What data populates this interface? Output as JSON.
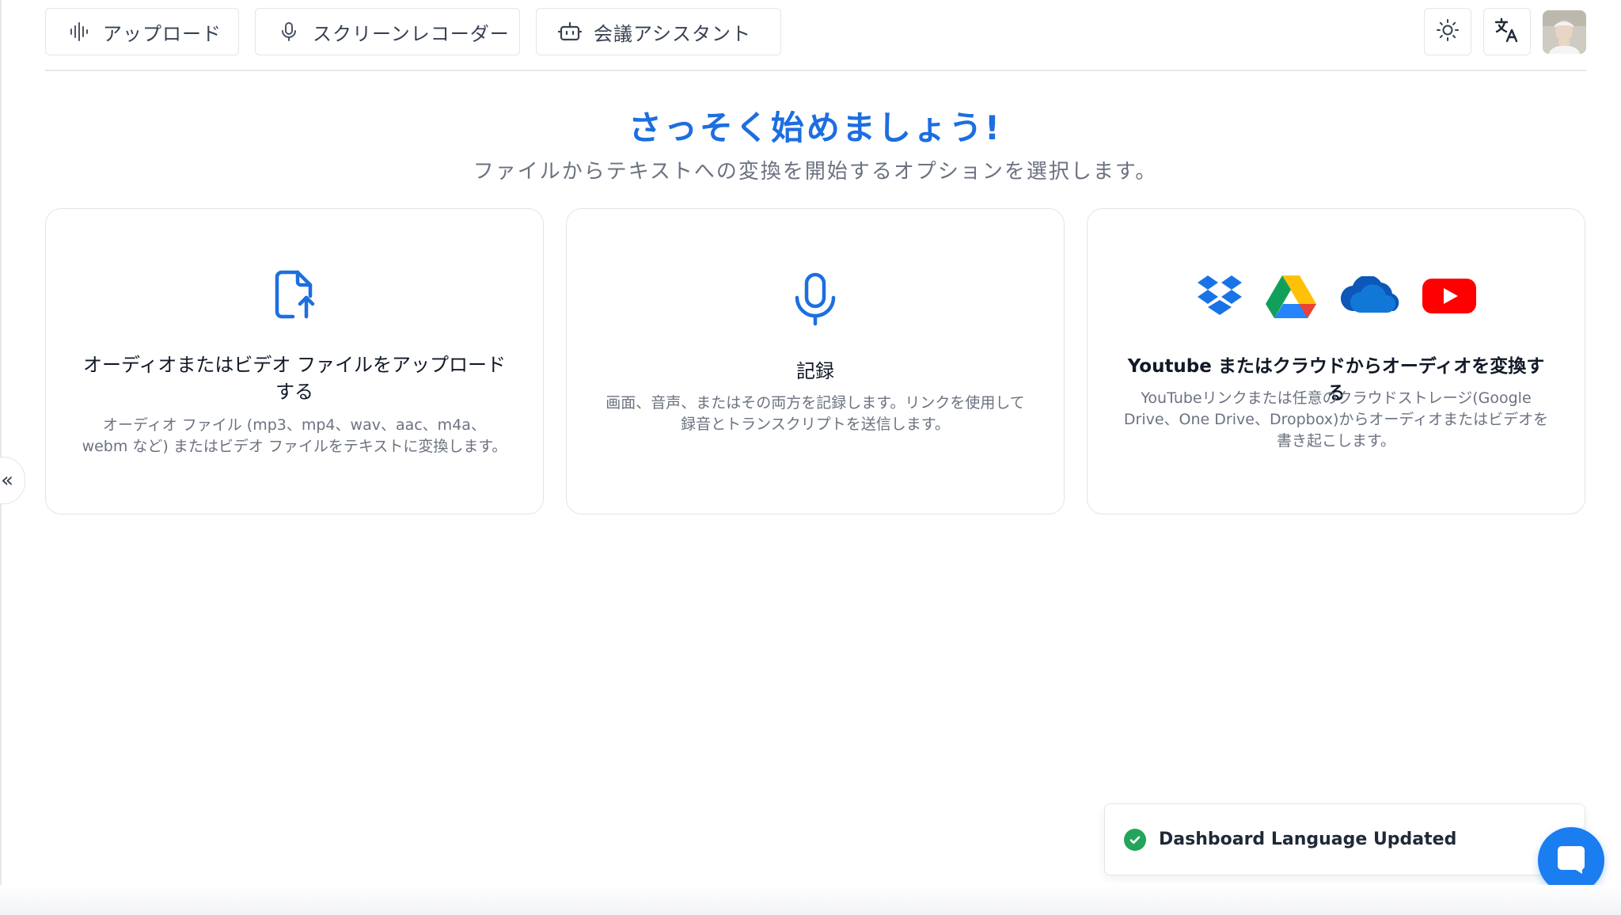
{
  "nav": {
    "upload_label": "アップロード",
    "recorder_label": "スクリーンレコーダー",
    "assistant_label": "会議アシスタント"
  },
  "hero": {
    "title": "さっそく始めましょう!",
    "subtitle": "ファイルからテキストへの変換を開始するオプションを選択します。"
  },
  "cards": [
    {
      "title": "オーディオまたはビデオ ファイルをアップロードする",
      "description": "オーディオ ファイル (mp3、mp4、wav、aac、m4a、webm など) またはビデオ ファイルをテキストに変換します。",
      "icon": "file-upload-icon"
    },
    {
      "title": "記録",
      "description": "画面、音声、またはその両方を記録します。リンクを使用して録音とトランスクリプトを送信します。",
      "icon": "microphone-icon"
    },
    {
      "title": "Youtube またはクラウドからオーディオを変換する",
      "description": "YouTubeリンクまたは任意のクラウドストレージ(Google Drive、One Drive、Dropbox)からオーディオまたはビデオを書き起こします。",
      "icons": [
        "dropbox-icon",
        "google-drive-icon",
        "onedrive-icon",
        "youtube-icon"
      ]
    }
  ],
  "collapse_handle": "«",
  "toast": {
    "message": "Dashboard Language Updated"
  },
  "colors": {
    "accent": "#1d6ee0",
    "success": "#22a55a",
    "chat": "#1a7df0"
  }
}
